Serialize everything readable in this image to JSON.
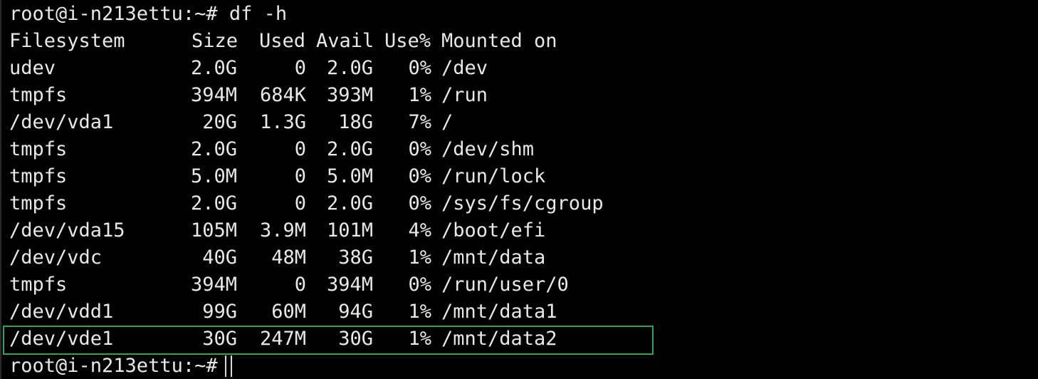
{
  "terminal": {
    "command_prompt": "root@i-n213ettu:~# df -h",
    "final_prompt": "root@i-n213ettu:~# ",
    "highlight_color": "#2ea44f",
    "header": {
      "filesystem": "Filesystem",
      "size": "Size",
      "used": "Used",
      "avail": "Avail",
      "use_pct": "Use%",
      "mounted_on": "Mounted on"
    },
    "rows": [
      {
        "filesystem": "udev",
        "size": "2.0G",
        "used": "0",
        "avail": "2.0G",
        "use_pct": "0%",
        "mounted_on": "/dev"
      },
      {
        "filesystem": "tmpfs",
        "size": "394M",
        "used": "684K",
        "avail": "393M",
        "use_pct": "1%",
        "mounted_on": "/run"
      },
      {
        "filesystem": "/dev/vda1",
        "size": "20G",
        "used": "1.3G",
        "avail": "18G",
        "use_pct": "7%",
        "mounted_on": "/"
      },
      {
        "filesystem": "tmpfs",
        "size": "2.0G",
        "used": "0",
        "avail": "2.0G",
        "use_pct": "0%",
        "mounted_on": "/dev/shm"
      },
      {
        "filesystem": "tmpfs",
        "size": "5.0M",
        "used": "0",
        "avail": "5.0M",
        "use_pct": "0%",
        "mounted_on": "/run/lock"
      },
      {
        "filesystem": "tmpfs",
        "size": "2.0G",
        "used": "0",
        "avail": "2.0G",
        "use_pct": "0%",
        "mounted_on": "/sys/fs/cgroup"
      },
      {
        "filesystem": "/dev/vda15",
        "size": "105M",
        "used": "3.9M",
        "avail": "101M",
        "use_pct": "4%",
        "mounted_on": "/boot/efi"
      },
      {
        "filesystem": "/dev/vdc",
        "size": "40G",
        "used": "48M",
        "avail": "38G",
        "use_pct": "1%",
        "mounted_on": "/mnt/data"
      },
      {
        "filesystem": "tmpfs",
        "size": "394M",
        "used": "0",
        "avail": "394M",
        "use_pct": "0%",
        "mounted_on": "/run/user/0"
      },
      {
        "filesystem": "/dev/vdd1",
        "size": "99G",
        "used": "60M",
        "avail": "94G",
        "use_pct": "1%",
        "mounted_on": "/mnt/data1"
      },
      {
        "filesystem": "/dev/vde1",
        "size": "30G",
        "used": "247M",
        "avail": "30G",
        "use_pct": "1%",
        "mounted_on": "/mnt/data2"
      }
    ]
  }
}
